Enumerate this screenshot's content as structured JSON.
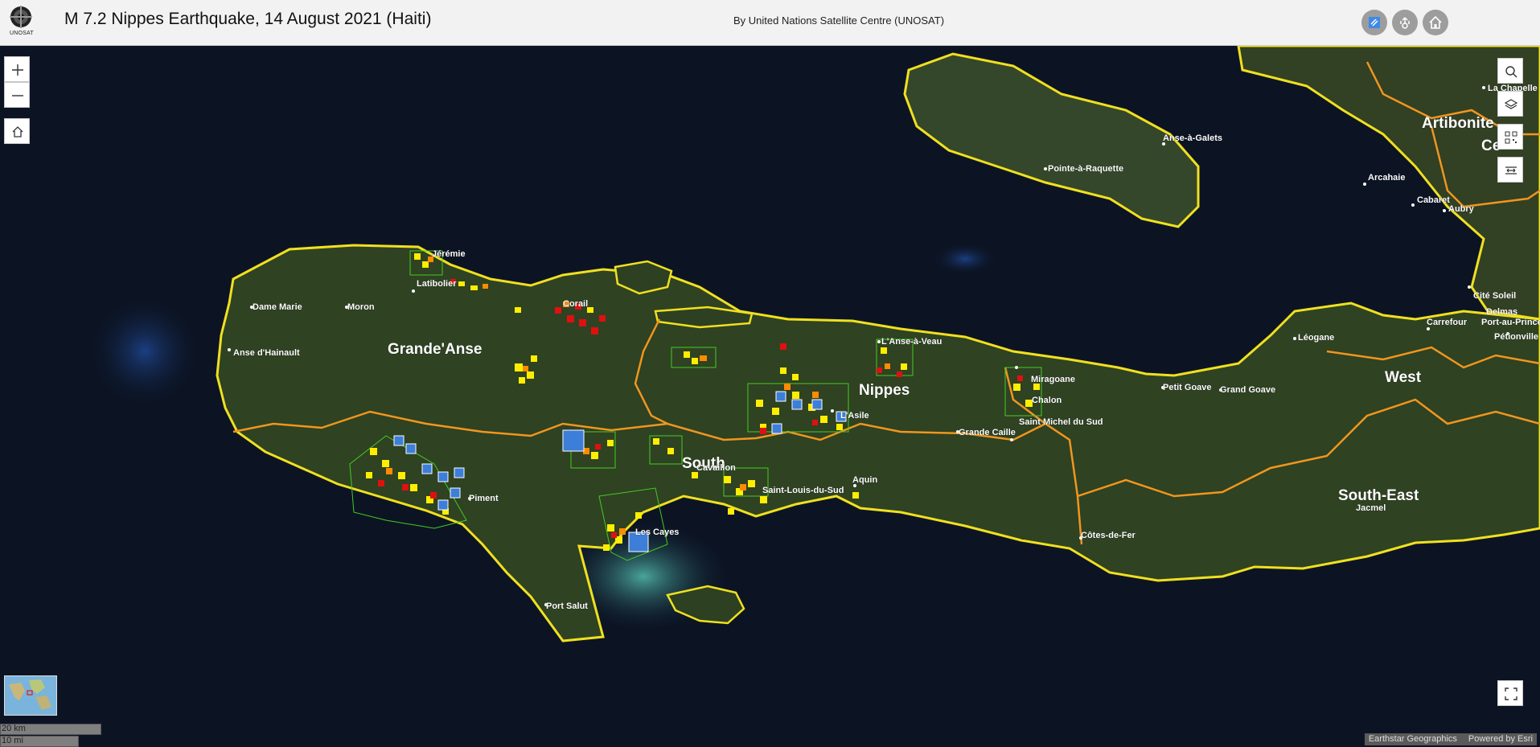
{
  "header": {
    "logo_text": "UNOSAT",
    "title": "M 7.2 Nippes Earthquake, 14 August 2021 (Haiti)",
    "subtitle": "By United Nations Satellite Centre (UNOSAT)",
    "buttons": [
      {
        "name": "unosat-logo-button",
        "icon": "unosat-icon"
      },
      {
        "name": "share-button",
        "icon": "share-icon"
      },
      {
        "name": "home-button",
        "icon": "home-icon"
      }
    ]
  },
  "map_controls": {
    "zoom_in_icon": "plus-icon",
    "zoom_out_icon": "minus-icon",
    "default_extent_icon": "home-icon",
    "right_tools": [
      "search-icon",
      "layers-icon",
      "qr-code-icon",
      "swipe-icon"
    ],
    "fullscreen_icon": "fullscreen-icon"
  },
  "departments": {
    "grande_anse": "Grande'Anse",
    "nippes": "Nippes",
    "south": "South",
    "west": "West",
    "south_east": "South-East",
    "artibonite": "Artibonite",
    "centre_partial": "Ce"
  },
  "places": {
    "jeremie": "Jérémie",
    "latibolier": "Latibolier",
    "corail": "Corail",
    "dame_marie": "Dame Marie",
    "moron": "Moron",
    "anse_hainault": "Anse d'Hainault",
    "anse_a_veau": "L'Anse-à-Veau",
    "miragoane": "Miragoane",
    "chalon": "Chalon",
    "asile": "L'Asile",
    "saint_michel": "Saint Michel du Sud",
    "grande_caille": "Grande Caille",
    "cavaillon": "Cavaillon",
    "saint_louis": "Saint-Louis-du-Sud",
    "aquin": "Aquin",
    "piment": "Piment",
    "les_cayes": "Les Cayes",
    "port_salut": "Port Salut",
    "cotes_de_fer": "Côtes-de-Fer",
    "jacmel": "Jacmel",
    "petit_goave": "Petit Goave",
    "grand_goave": "Grand Goave",
    "leogane": "Léogane",
    "anse_a_galets": "Anse-à-Galets",
    "pointe_a_raquette": "Pointe-à-Raquette",
    "arcahaie": "Arcahaie",
    "cabaret": "Cabaret",
    "aubry": "Aubry",
    "la_chapelle": "La Chapelle",
    "cite_soleil": "Cité Soleil",
    "delmas": "Delmas",
    "carrefour": "Carrefour",
    "port_au_prince": "Port-au-Prince",
    "petionville": "Pétionville"
  },
  "damage_colors": {
    "destroyed": "#e01010",
    "severe": "#ff8c00",
    "moderate": "#ffee00",
    "boundary": "#f0e020",
    "department_line": "#f0961e",
    "aoi": "#44cc22"
  },
  "scalebar": {
    "km": "20 km",
    "mi": "10 mi"
  },
  "attribution": {
    "imagery": "Earthstar Geographics",
    "powered": "Powered by Esri"
  }
}
